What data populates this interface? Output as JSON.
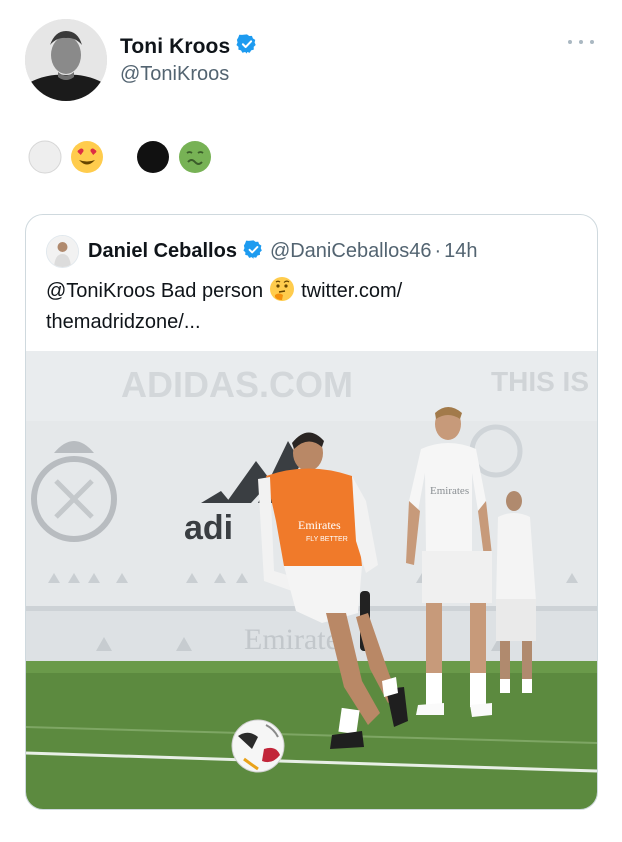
{
  "author": {
    "display_name": "Toni Kroos",
    "handle": "@ToniKroos",
    "verified": true
  },
  "tweet_emojis": [
    "white-circle",
    "heart-eyes-face",
    "black-circle",
    "nauseated-face"
  ],
  "quoted_tweet": {
    "display_name": "Daniel Ceballos",
    "handle": "@DaniCeballos46",
    "separator": "·",
    "time": "14h",
    "verified": true,
    "text_mention": "@ToniKroos",
    "text_body": "Bad person",
    "text_emoji": "thinking-face",
    "link_line1": "twitter.com/",
    "link_line2": "themadridzone/..."
  },
  "photo": {
    "banner_left": "ADIDAS.COM",
    "banner_right": "THIS IS GR",
    "board_text": "Emirates",
    "vest_text_1": "Emirates",
    "vest_text_2": "FLY BETTER"
  },
  "colors": {
    "verified_blue": "#1d9bf0",
    "text_primary": "#0f1419",
    "text_secondary": "#536471",
    "bib_orange": "#f07a2a",
    "pitch_green": "#5c8a3f"
  }
}
